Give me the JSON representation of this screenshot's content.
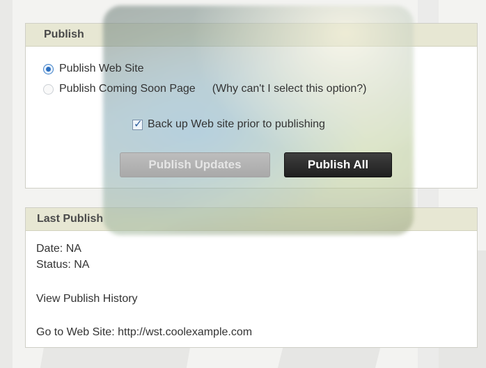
{
  "publish": {
    "header": "Publish",
    "options": [
      {
        "label": "Publish Web Site",
        "checked": true,
        "enabled": true
      },
      {
        "label": "Publish Coming Soon Page",
        "checked": false,
        "enabled": false
      }
    ],
    "help_link": "(Why can't I select this option?)",
    "backup_label": "Back up Web site prior to publishing",
    "backup_checked": true,
    "publish_updates_label": "Publish Updates",
    "publish_all_label": "Publish All"
  },
  "last_publish": {
    "header": "Last Publish",
    "date": "Date: NA",
    "status": "Status: NA",
    "history_link": "View Publish History",
    "site_prefix": "Go to Web Site: ",
    "site_url": "http://wst.coolexample.com"
  }
}
